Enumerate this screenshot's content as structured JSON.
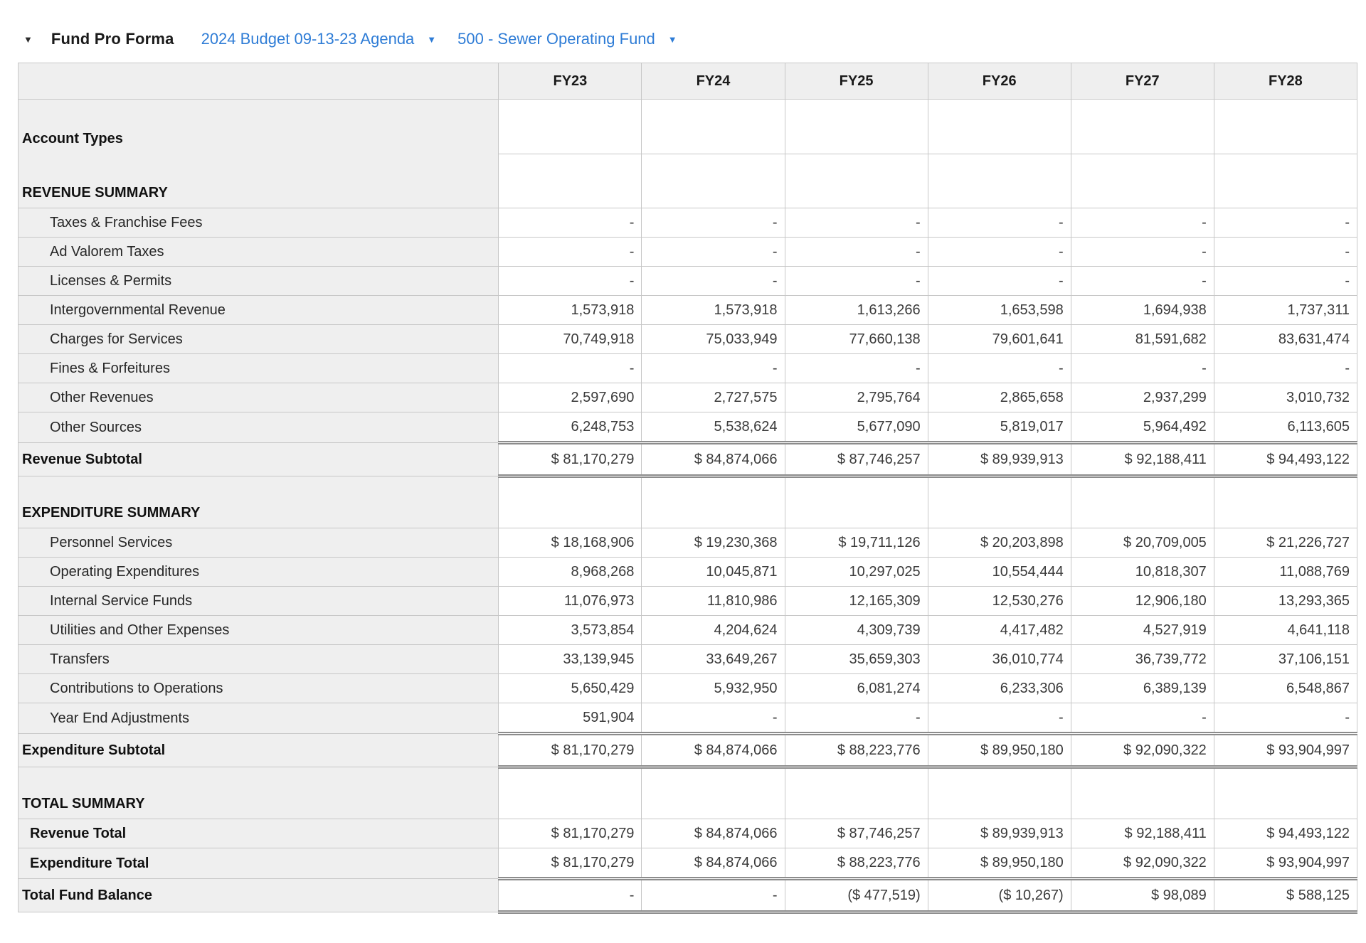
{
  "header": {
    "collapse_icon": "▼",
    "title": "Fund Pro Forma",
    "dropdowns": [
      {
        "label": "2024 Budget 09-13-23 Agenda",
        "caret": "▼"
      },
      {
        "label": "500 - Sewer Operating Fund",
        "caret": "▼"
      }
    ]
  },
  "colors": {
    "accent_blue": "#2e7cd6",
    "header_bg": "#efefef",
    "grid_line": "#c7c7c7",
    "double_rule": "#8c8c8c"
  },
  "table": {
    "columns": [
      "FY23",
      "FY24",
      "FY25",
      "FY26",
      "FY27",
      "FY28"
    ],
    "corner_label": "",
    "rows": [
      {
        "type": "section",
        "label": "Account Types",
        "merged_with_next": true,
        "values": [
          "",
          "",
          "",
          "",
          "",
          ""
        ]
      },
      {
        "type": "section",
        "label": "REVENUE SUMMARY",
        "merged_with_prev": true,
        "values": [
          "",
          "",
          "",
          "",
          "",
          ""
        ]
      },
      {
        "type": "data",
        "label": "Taxes & Franchise Fees",
        "values": [
          "-",
          "-",
          "-",
          "-",
          "-",
          "-"
        ]
      },
      {
        "type": "data",
        "label": "Ad Valorem Taxes",
        "values": [
          "-",
          "-",
          "-",
          "-",
          "-",
          "-"
        ]
      },
      {
        "type": "data",
        "label": "Licenses & Permits",
        "values": [
          "-",
          "-",
          "-",
          "-",
          "-",
          "-"
        ]
      },
      {
        "type": "data",
        "label": "Intergovernmental Revenue",
        "values": [
          "1,573,918",
          "1,573,918",
          "1,613,266",
          "1,653,598",
          "1,694,938",
          "1,737,311"
        ]
      },
      {
        "type": "data",
        "label": "Charges for Services",
        "values": [
          "70,749,918",
          "75,033,949",
          "77,660,138",
          "79,601,641",
          "81,591,682",
          "83,631,474"
        ]
      },
      {
        "type": "data",
        "label": "Fines & Forfeitures",
        "values": [
          "-",
          "-",
          "-",
          "-",
          "-",
          "-"
        ]
      },
      {
        "type": "data",
        "label": "Other Revenues",
        "values": [
          "2,597,690",
          "2,727,575",
          "2,795,764",
          "2,865,658",
          "2,937,299",
          "3,010,732"
        ]
      },
      {
        "type": "data",
        "label": "Other Sources",
        "values": [
          "6,248,753",
          "5,538,624",
          "5,677,090",
          "5,819,017",
          "5,964,492",
          "6,113,605"
        ]
      },
      {
        "type": "subtotal",
        "label": "Revenue Subtotal",
        "values": [
          "$ 81,170,279",
          "$ 84,874,066",
          "$ 87,746,257",
          "$ 89,939,913",
          "$ 92,188,411",
          "$ 94,493,122"
        ]
      },
      {
        "type": "section-gap",
        "label": "EXPENDITURE SUMMARY",
        "values": [
          "",
          "",
          "",
          "",
          "",
          ""
        ]
      },
      {
        "type": "data",
        "label": "Personnel Services",
        "values": [
          "$ 18,168,906",
          "$ 19,230,368",
          "$ 19,711,126",
          "$ 20,203,898",
          "$ 20,709,005",
          "$ 21,226,727"
        ]
      },
      {
        "type": "data",
        "label": "Operating Expenditures",
        "values": [
          "8,968,268",
          "10,045,871",
          "10,297,025",
          "10,554,444",
          "10,818,307",
          "11,088,769"
        ]
      },
      {
        "type": "data",
        "label": "Internal Service Funds",
        "values": [
          "11,076,973",
          "11,810,986",
          "12,165,309",
          "12,530,276",
          "12,906,180",
          "13,293,365"
        ]
      },
      {
        "type": "data",
        "label": "Utilities and Other Expenses",
        "values": [
          "3,573,854",
          "4,204,624",
          "4,309,739",
          "4,417,482",
          "4,527,919",
          "4,641,118"
        ]
      },
      {
        "type": "data",
        "label": "Transfers",
        "values": [
          "33,139,945",
          "33,649,267",
          "35,659,303",
          "36,010,774",
          "36,739,772",
          "37,106,151"
        ]
      },
      {
        "type": "data",
        "label": "Contributions to Operations",
        "values": [
          "5,650,429",
          "5,932,950",
          "6,081,274",
          "6,233,306",
          "6,389,139",
          "6,548,867"
        ]
      },
      {
        "type": "data",
        "label": "Year End Adjustments",
        "values": [
          "591,904",
          "-",
          "-",
          "-",
          "-",
          "-"
        ]
      },
      {
        "type": "subtotal",
        "label": "Expenditure Subtotal",
        "values": [
          "$ 81,170,279",
          "$ 84,874,066",
          "$ 88,223,776",
          "$ 89,950,180",
          "$ 92,090,322",
          "$ 93,904,997"
        ]
      },
      {
        "type": "section-gap",
        "label": "TOTAL SUMMARY",
        "values": [
          "",
          "",
          "",
          "",
          "",
          ""
        ]
      },
      {
        "type": "total",
        "label": "Revenue Total",
        "values": [
          "$ 81,170,279",
          "$ 84,874,066",
          "$ 87,746,257",
          "$ 89,939,913",
          "$ 92,188,411",
          "$ 94,493,122"
        ]
      },
      {
        "type": "total",
        "label": "Expenditure Total",
        "values": [
          "$ 81,170,279",
          "$ 84,874,066",
          "$ 88,223,776",
          "$ 89,950,180",
          "$ 92,090,322",
          "$ 93,904,997"
        ]
      },
      {
        "type": "balance",
        "label": "Total Fund Balance",
        "values": [
          "-",
          "-",
          "($ 477,519)",
          "($ 10,267)",
          "$ 98,089",
          "$ 588,125"
        ]
      }
    ]
  }
}
